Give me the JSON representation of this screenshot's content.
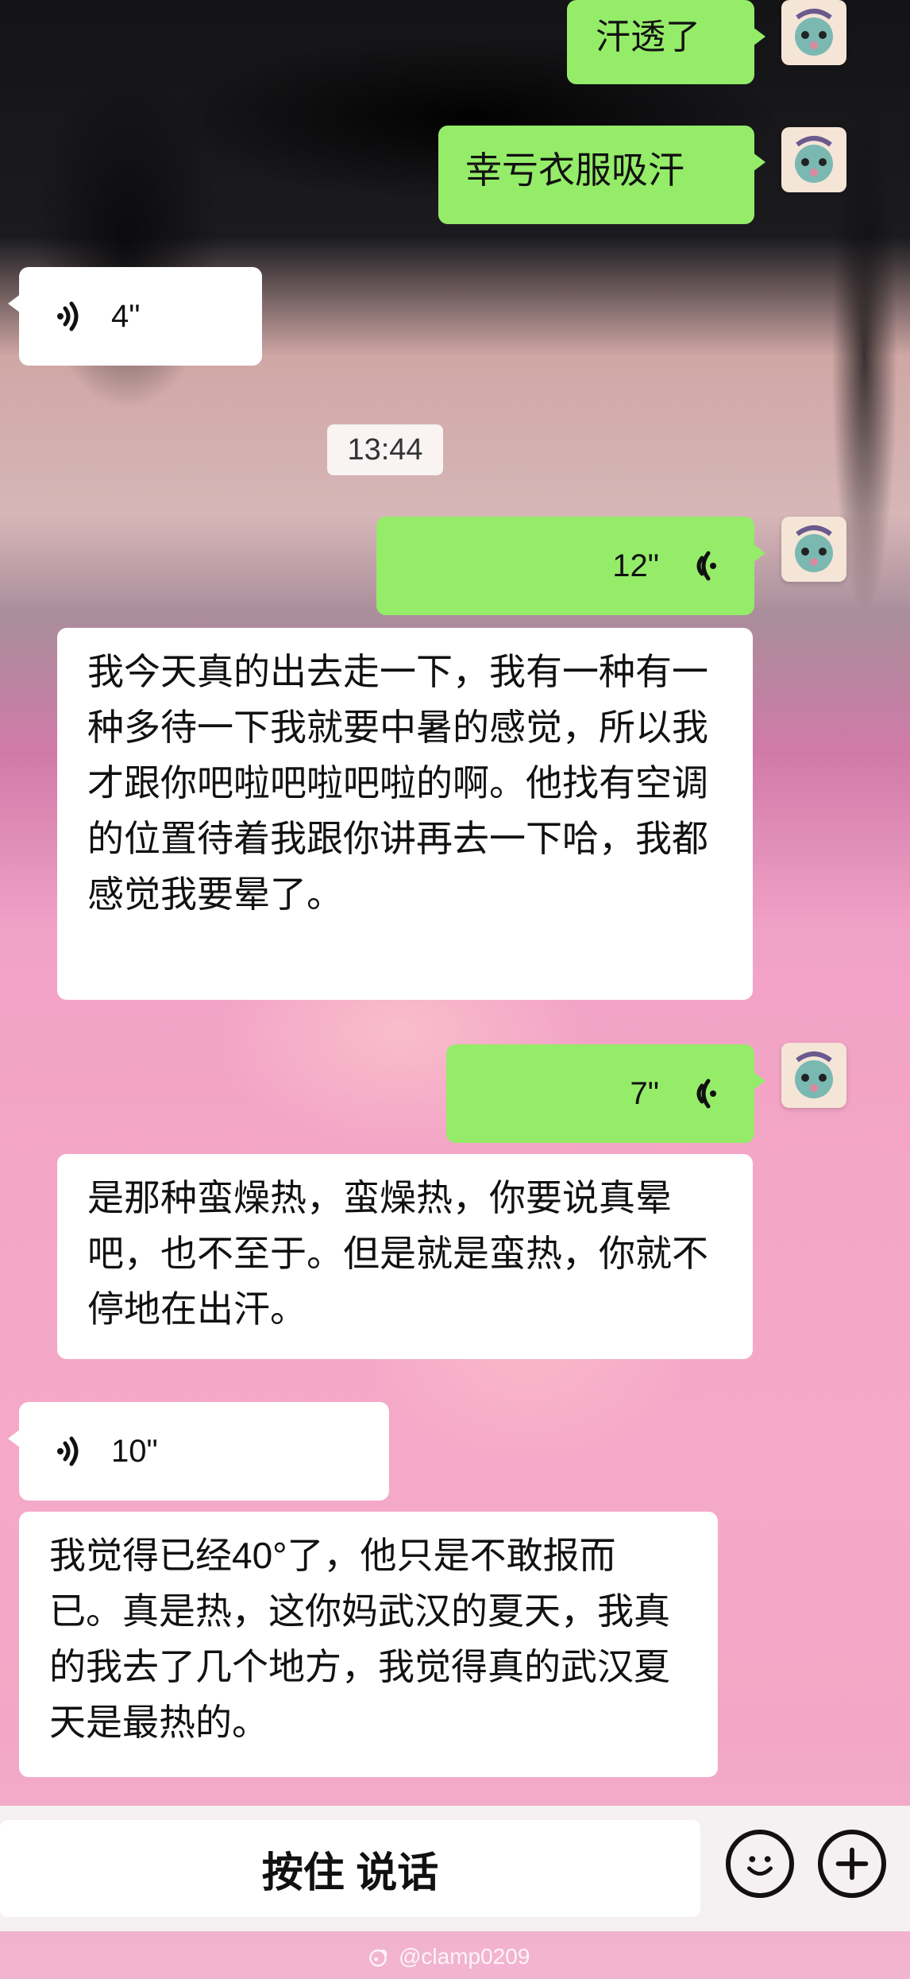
{
  "messages": [
    {
      "id": "m1",
      "side": "me",
      "type": "text",
      "text": "汗透了"
    },
    {
      "id": "m2",
      "side": "me",
      "type": "text",
      "text": "幸亏衣服吸汗"
    },
    {
      "id": "m3",
      "side": "them",
      "type": "voice",
      "duration": "4\""
    },
    {
      "id": "t1",
      "type": "time",
      "text": "13:44"
    },
    {
      "id": "m4",
      "side": "me",
      "type": "voice",
      "duration": "12\"",
      "transcript": "我今天真的出去走一下，我有一种有一种多待一下我就要中暑的感觉，所以我才跟你吧啦吧啦吧啦的啊。他找有空调的位置待着我跟你讲再去一下哈，我都感觉我要晕了。"
    },
    {
      "id": "m5",
      "side": "me",
      "type": "voice",
      "duration": "7\"",
      "transcript": "是那种蛮燥热，蛮燥热，你要说真晕吧，也不至于。但是就是蛮热，你就不停地在出汗。"
    },
    {
      "id": "m6",
      "side": "them",
      "type": "voice",
      "duration": "10\"",
      "transcript": "我觉得已经40°了，他只是不敢报而已。真是热，这你妈武汉的夏天，我真的我去了几个地方，我觉得真的武汉夏天是最热的。"
    }
  ],
  "input_bar": {
    "hold_to_talk_label": "按住 说话",
    "emoji_icon": "smiley-icon",
    "plus_icon": "plus-icon"
  },
  "watermark": {
    "text": "@clamp0209"
  },
  "colors": {
    "me_bubble": "#95ec69",
    "them_bubble": "#ffffff"
  },
  "icons": {
    "voice_wave": "voice-wave-icon",
    "avatar": "plush-avatar-icon",
    "watermark_logo": "weibo-icon"
  }
}
